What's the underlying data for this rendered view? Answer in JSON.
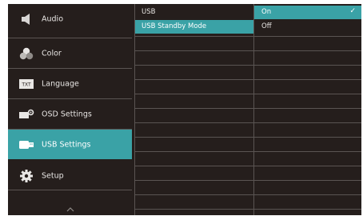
{
  "main_menu": {
    "items": [
      {
        "label": "Audio",
        "icon": "speaker-icon",
        "selected": false
      },
      {
        "label": "Color",
        "icon": "color-icon",
        "selected": false
      },
      {
        "label": "Language",
        "icon": "language-icon",
        "selected": false
      },
      {
        "label": "OSD Settings",
        "icon": "osd-settings-icon",
        "selected": false
      },
      {
        "label": "USB Settings",
        "icon": "usb-icon",
        "selected": true
      },
      {
        "label": "Setup",
        "icon": "gear-icon",
        "selected": false
      }
    ],
    "language_icon_text": "TXT"
  },
  "submenu": {
    "items": [
      {
        "label": "USB",
        "selected": false
      },
      {
        "label": "USB Standby Mode",
        "selected": true
      }
    ]
  },
  "options": {
    "items": [
      {
        "label": "On",
        "selected": true,
        "checked": true
      },
      {
        "label": "Off",
        "selected": false,
        "checked": false
      }
    ],
    "check_glyph": "✓"
  },
  "colors": {
    "background": "#251e1c",
    "highlight": "#3aa2a6",
    "separator": "#5a5452",
    "text": "#e8e6e4"
  }
}
